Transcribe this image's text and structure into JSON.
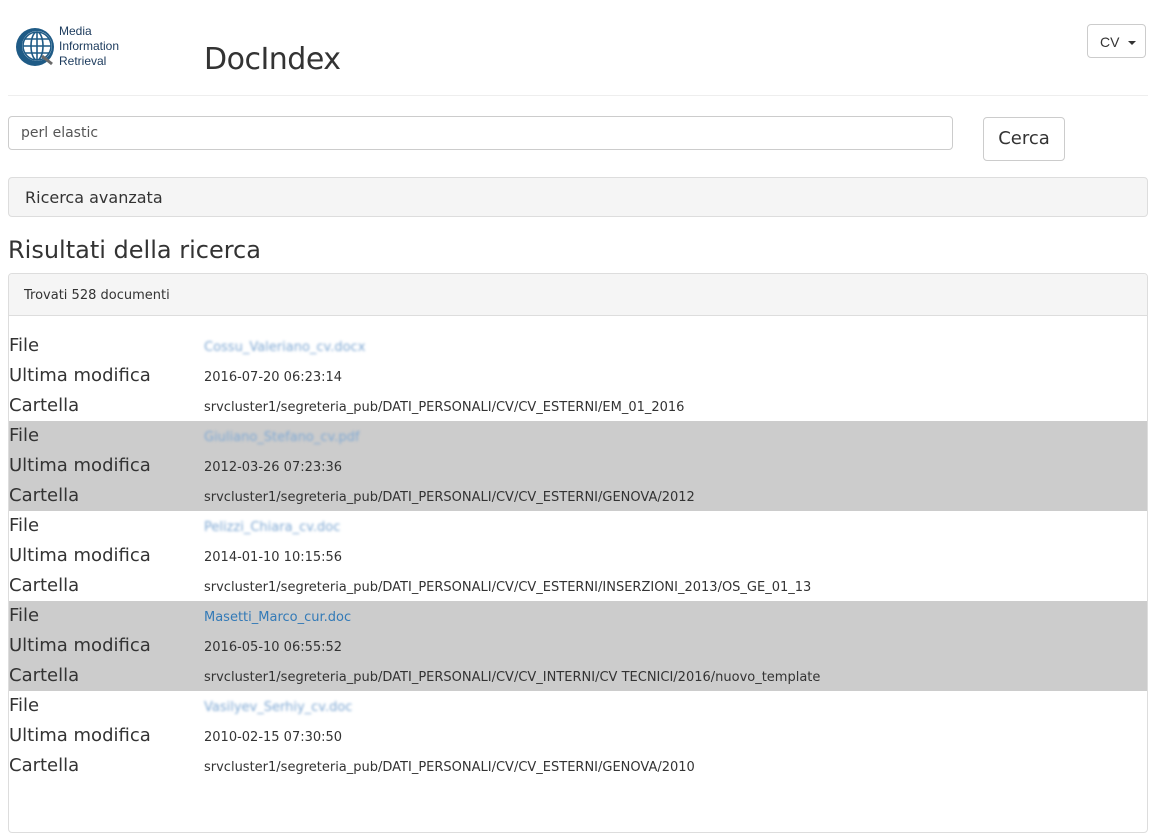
{
  "logo": {
    "line1": "Media",
    "line2": "Information",
    "line3": "Retrieval"
  },
  "app_title": "DocIndex",
  "collection_select": {
    "value": "CV"
  },
  "search": {
    "value": "perl elastic",
    "button_label": "Cerca"
  },
  "advanced_search_label": "Ricerca avanzata",
  "results_title": "Risultati della ricerca",
  "results_count_text": "Trovati 528 documenti",
  "field_labels": {
    "file": "File",
    "modified": "Ultima modifica",
    "folder": "Cartella"
  },
  "results": [
    {
      "file": "Cossu_Valeriano_cv.docx",
      "modified": "2016-07-20 06:23:14",
      "folder": "srvcluster1/segreteria_pub/DATI_PERSONALI/CV/CV_ESTERNI/EM_01_2016",
      "blurred": true
    },
    {
      "file": "Giuliano_Stefano_cv.pdf",
      "modified": "2012-03-26 07:23:36",
      "folder": "srvcluster1/segreteria_pub/DATI_PERSONALI/CV/CV_ESTERNI/GENOVA/2012",
      "blurred": true
    },
    {
      "file": "Pelizzi_Chiara_cv.doc",
      "modified": "2014-01-10 10:15:56",
      "folder": "srvcluster1/segreteria_pub/DATI_PERSONALI/CV/CV_ESTERNI/INSERZIONI_2013/OS_GE_01_13",
      "blurred": true
    },
    {
      "file": "Masetti_Marco_cur.doc",
      "modified": "2016-05-10 06:55:52",
      "folder": "srvcluster1/segreteria_pub/DATI_PERSONALI/CV/CV_INTERNI/CV TECNICI/2016/nuovo_template",
      "blurred": false
    },
    {
      "file": "Vasilyev_Serhiy_cv.doc",
      "modified": "2010-02-15 07:30:50",
      "folder": "srvcluster1/segreteria_pub/DATI_PERSONALI/CV/CV_ESTERNI/GENOVA/2010",
      "blurred": true
    }
  ]
}
